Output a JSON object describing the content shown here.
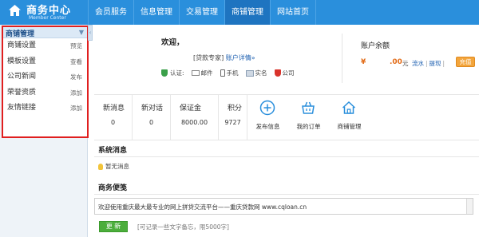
{
  "header": {
    "title": "商务中心",
    "subtitle": "Member Center",
    "nav": [
      "会员服务",
      "信息管理",
      "交易管理",
      "商铺管理",
      "网站首页"
    ],
    "active_index": 3,
    "accent": "#2a8fdc"
  },
  "sidebar": {
    "heading": "商铺管理",
    "highlight_color": "#e01f1f",
    "items": [
      {
        "label": "商铺设置",
        "action": "预览"
      },
      {
        "label": "模板设置",
        "action": "查看"
      },
      {
        "label": "公司新闻",
        "action": "发布"
      },
      {
        "label": "荣誉资质",
        "action": "添加"
      },
      {
        "label": "友情链接",
        "action": "添加"
      }
    ]
  },
  "welcome": {
    "greeting": "欢迎，",
    "role": "[贷款专家]",
    "account_link": "账户详情»",
    "verify_label": "认证:",
    "verifications": [
      "邮件",
      "手机",
      "实名",
      "公司"
    ]
  },
  "account": {
    "title": "账户余额",
    "currency": "¥",
    "amount": ".00",
    "unit": "元",
    "links": [
      "流水",
      "提现"
    ],
    "recharge": "充值"
  },
  "stats": [
    {
      "label": "新消息",
      "value": "0"
    },
    {
      "label": "新对话",
      "value": "0"
    },
    {
      "label": "保证金",
      "value": "8000.00"
    },
    {
      "label": "积分",
      "value": "9727"
    }
  ],
  "quick_actions": [
    {
      "label": "发布信息",
      "icon": "plus-circle-icon"
    },
    {
      "label": "我的订单",
      "icon": "basket-icon"
    },
    {
      "label": "商铺管理",
      "icon": "house-icon"
    }
  ],
  "system_messages": {
    "title": "系统消息",
    "empty_text": "暂无消息"
  },
  "memo": {
    "title": "商务便笺",
    "content": "欢迎使用重庆最大最专业的网上拼贷交流平台——重庆贷款网 www.cqloan.cn",
    "update_button": "更 新",
    "hint": "[可记录一些文字备忘，限5000字]"
  }
}
